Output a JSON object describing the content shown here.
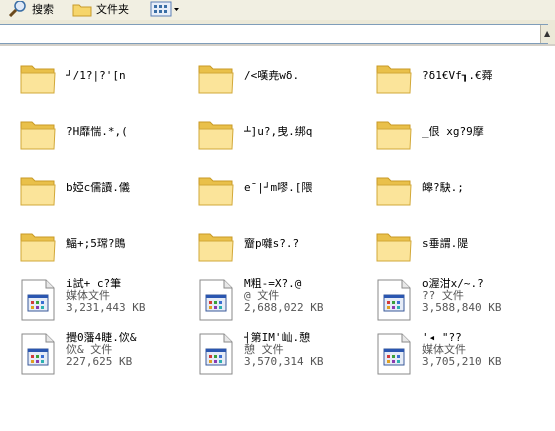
{
  "toolbar": {
    "search_label": "搜索",
    "folders_label": "文件夹"
  },
  "folders": [
    {
      "name": "┘/1?|?'[n"
    },
    {
      "name": "/<嘆尭wδ."
    },
    {
      "name": "?δ1€Vf┒.€蕣"
    },
    {
      "name": "?H靡惴.*,("
    },
    {
      "name": "┴]u?,曳.绑q"
    },
    {
      "name": "_佷 xg?9摩"
    },
    {
      "name": "b婭c儒讀.儀"
    },
    {
      "name": "eˉ|┘m嘐.[隈"
    },
    {
      "name": "皞?駃.;"
    },
    {
      "name": "鰏+;5瑺?鵖"
    },
    {
      "name": "齏p囃s?.?"
    },
    {
      "name": "s垂謂.隄"
    }
  ],
  "files": [
    {
      "name": "i試+ c?筆",
      "type": "媒体文件",
      "size": "3,231,443 KB"
    },
    {
      "name": "M粗-=X?.@",
      "type": "@ 文件",
      "size": "2,688,022 KB"
    },
    {
      "name": "o渥泔x/~.?",
      "type": "?? 文件",
      "size": "3,588,840 KB"
    },
    {
      "name": "攪0藩4睫.佽&",
      "type": "佽& 文件",
      "size": "227,625 KB"
    },
    {
      "name": "┤第IM'屾.憩",
      "type": "憩 文件",
      "size": "3,570,314 KB"
    },
    {
      "name": "'◂ \"??",
      "type": "媒体文件",
      "size": "3,705,210 KB"
    }
  ]
}
